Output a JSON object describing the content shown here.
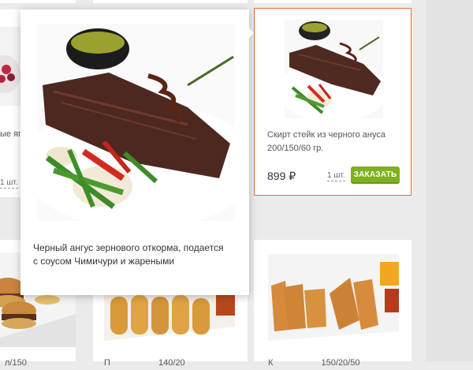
{
  "featured_card": {
    "name": "Скирт стейк из черного ануса 200/150/60 гр.",
    "price": "899 ₽",
    "qty": "1 шт.",
    "order_label": "ЗАКАЗАТЬ"
  },
  "left_card": {
    "name_fragment": "ые яге",
    "qty_fragment": "1 шт."
  },
  "popup": {
    "description": "Черный ангус зернового откорма, подается с соусом Чимичури и жареными"
  },
  "bottom_row": {
    "card1_text": "л/150",
    "card2_text": "П                    140/20",
    "card3_text": "К                    150/20/50"
  },
  "colors": {
    "accent": "#7fb11e",
    "featured_border": "#d9733f"
  }
}
